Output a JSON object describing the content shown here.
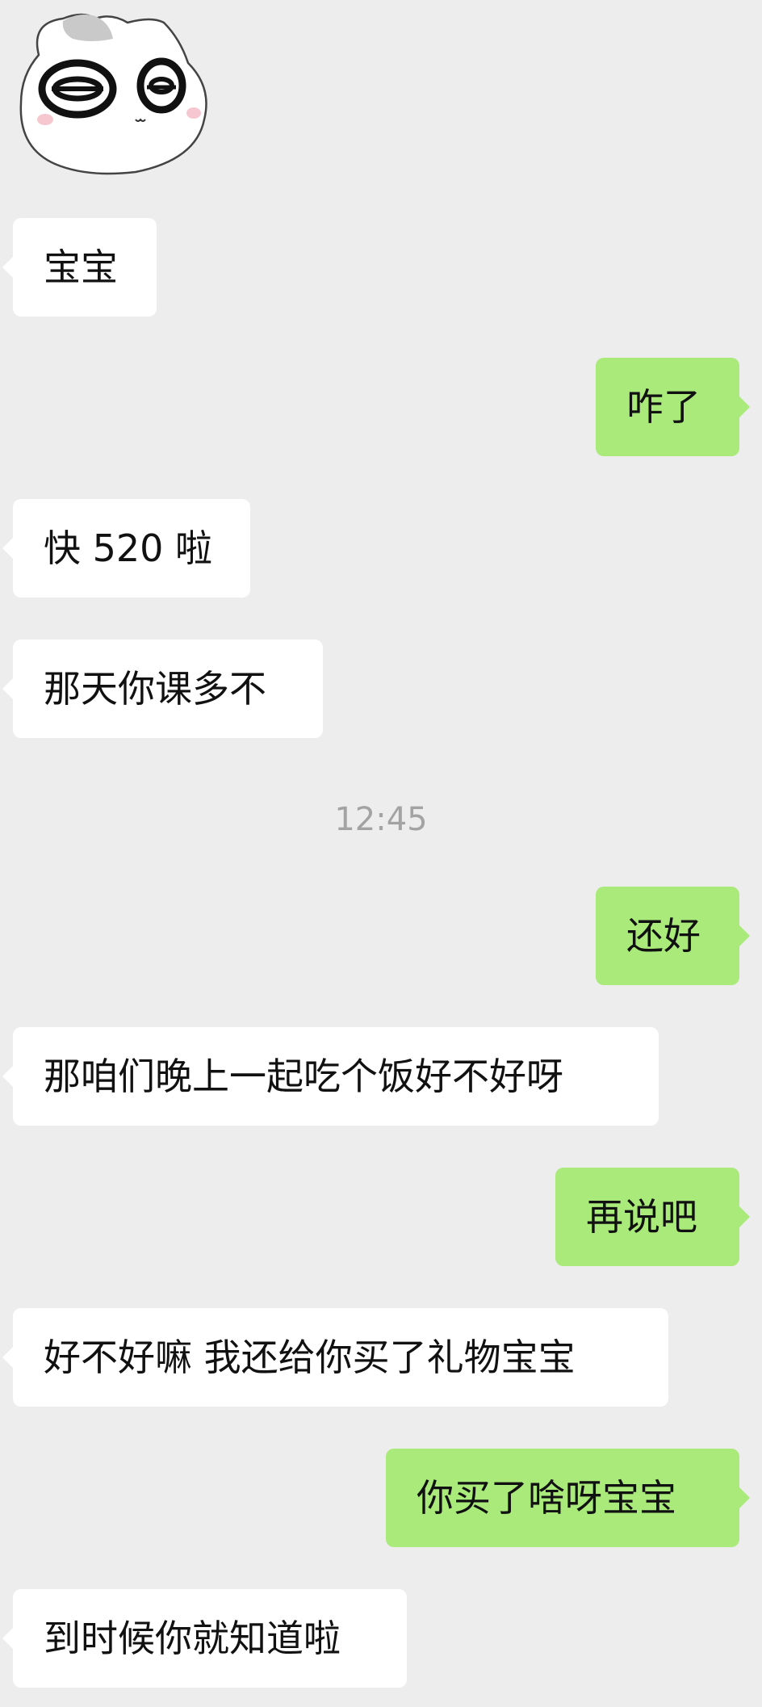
{
  "messages": [
    {
      "side": "in",
      "text": "宝宝"
    },
    {
      "side": "out",
      "text": "咋了"
    },
    {
      "side": "in",
      "text": "快 520 啦"
    },
    {
      "side": "in",
      "text": "那天你课多不"
    },
    {
      "side": "out",
      "text": "还好"
    },
    {
      "side": "in",
      "text": "那咱们晚上一起吃个饭好不好呀"
    },
    {
      "side": "out",
      "text": "再说吧"
    },
    {
      "side": "in",
      "text": "好不好嘛 我还给你买了礼物宝宝"
    },
    {
      "side": "out",
      "text": "你买了啥呀宝宝"
    },
    {
      "side": "in",
      "text": "到时候你就知道啦"
    }
  ],
  "timestamp": "12:45",
  "colors": {
    "background": "#ededed",
    "incoming_bubble": "#ffffff",
    "outgoing_bubble": "#a9ea7a",
    "timestamp": "#a3a3a3"
  },
  "sticker": {
    "icon": "cat-face-sticker"
  }
}
